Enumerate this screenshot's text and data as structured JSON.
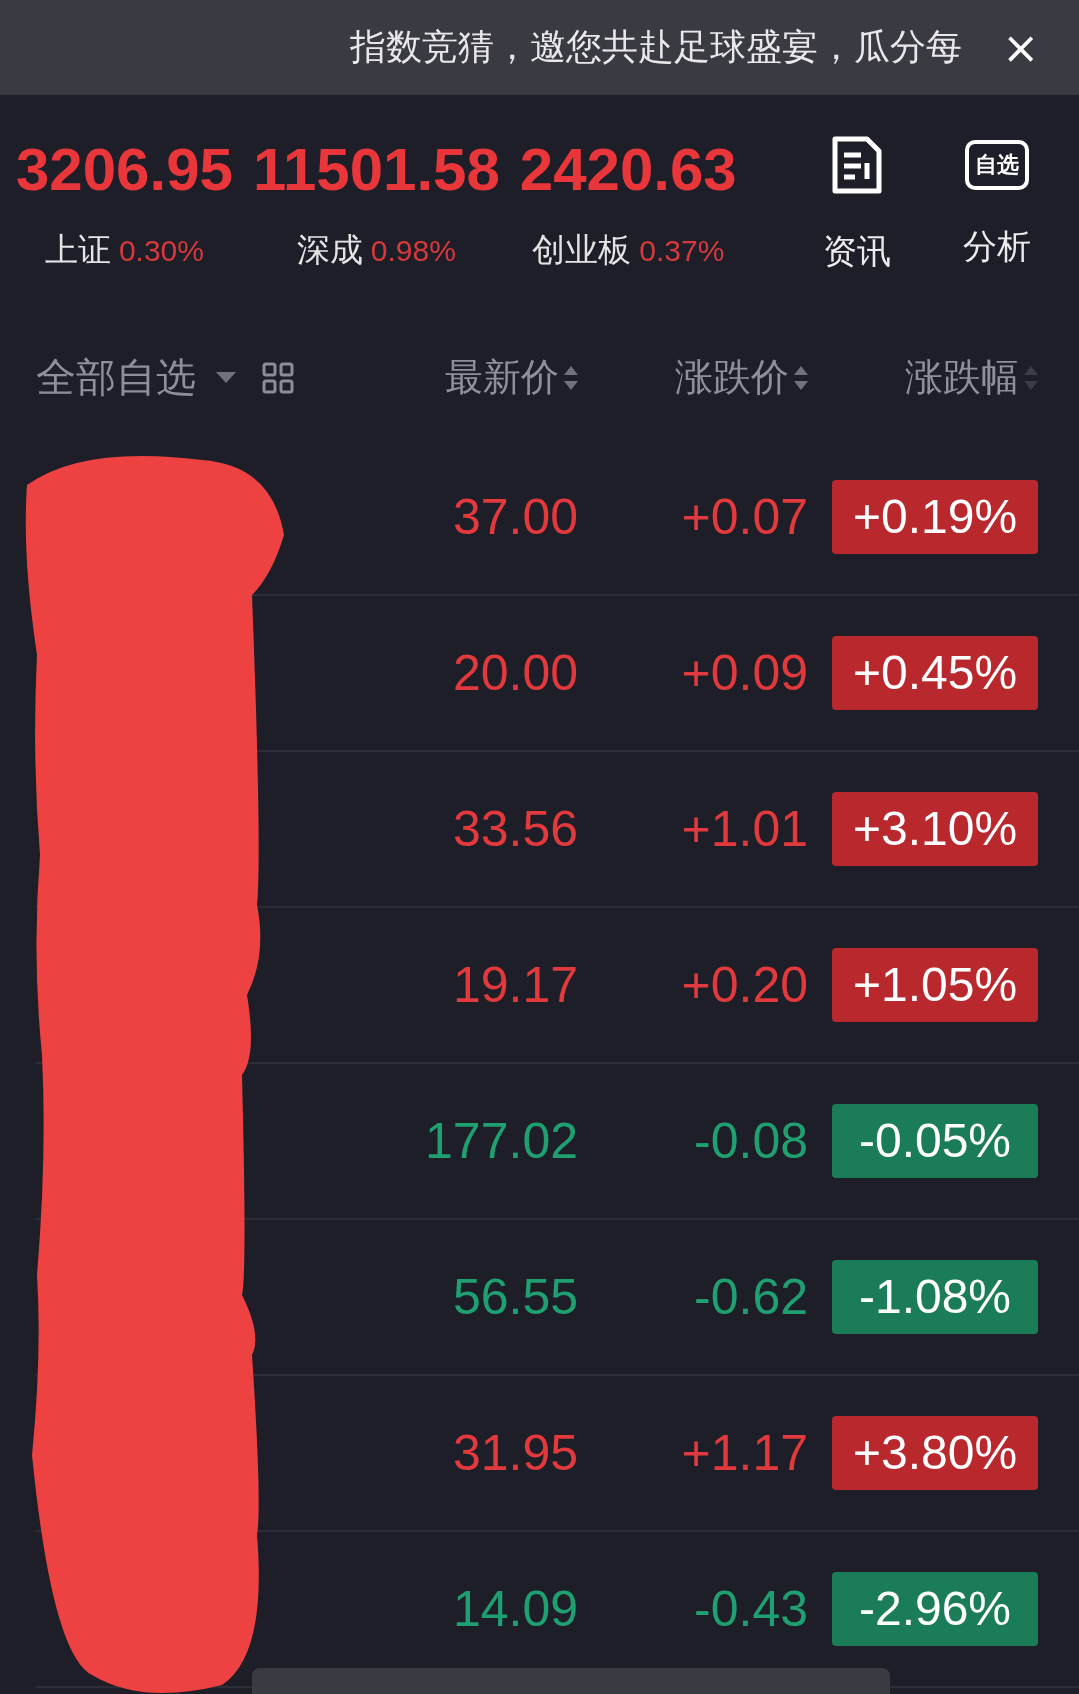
{
  "banner": {
    "text": "指数竞猜，邀您共赴足球盛宴，瓜分每",
    "close": "×"
  },
  "indices": [
    {
      "value": "3206.95",
      "name": "上证",
      "change": "0.30%"
    },
    {
      "value": "11501.58",
      "name": "深成",
      "change": "0.98%"
    },
    {
      "value": "2420.63",
      "name": "创业板",
      "change": "0.37%"
    }
  ],
  "shortcuts": [
    {
      "kind": "news",
      "label": "资讯"
    },
    {
      "kind": "watchlist",
      "label": "分析",
      "icon_text": "自选"
    }
  ],
  "table": {
    "group": "全部自选",
    "columns": [
      "最新价",
      "涨跌价",
      "涨跌幅"
    ],
    "rows": [
      {
        "price": "37.00",
        "change": "+0.07",
        "percent": "+0.19%",
        "kind": "up"
      },
      {
        "price": "20.00",
        "change": "+0.09",
        "percent": "+0.45%",
        "kind": "up"
      },
      {
        "price": "33.56",
        "change": "+1.01",
        "percent": "+3.10%",
        "kind": "up"
      },
      {
        "price": "19.17",
        "change": "+0.20",
        "percent": "+1.05%",
        "kind": "up"
      },
      {
        "price": "177.02",
        "change": "-0.08",
        "percent": "-0.05%",
        "kind": "down"
      },
      {
        "price": "56.55",
        "change": "-0.62",
        "percent": "-1.08%",
        "kind": "down"
      },
      {
        "price": "31.95",
        "change": "+1.17",
        "percent": "+3.80%",
        "kind": "up"
      },
      {
        "price": "14.09",
        "change": "-0.43",
        "percent": "-2.96%",
        "kind": "down"
      }
    ]
  }
}
